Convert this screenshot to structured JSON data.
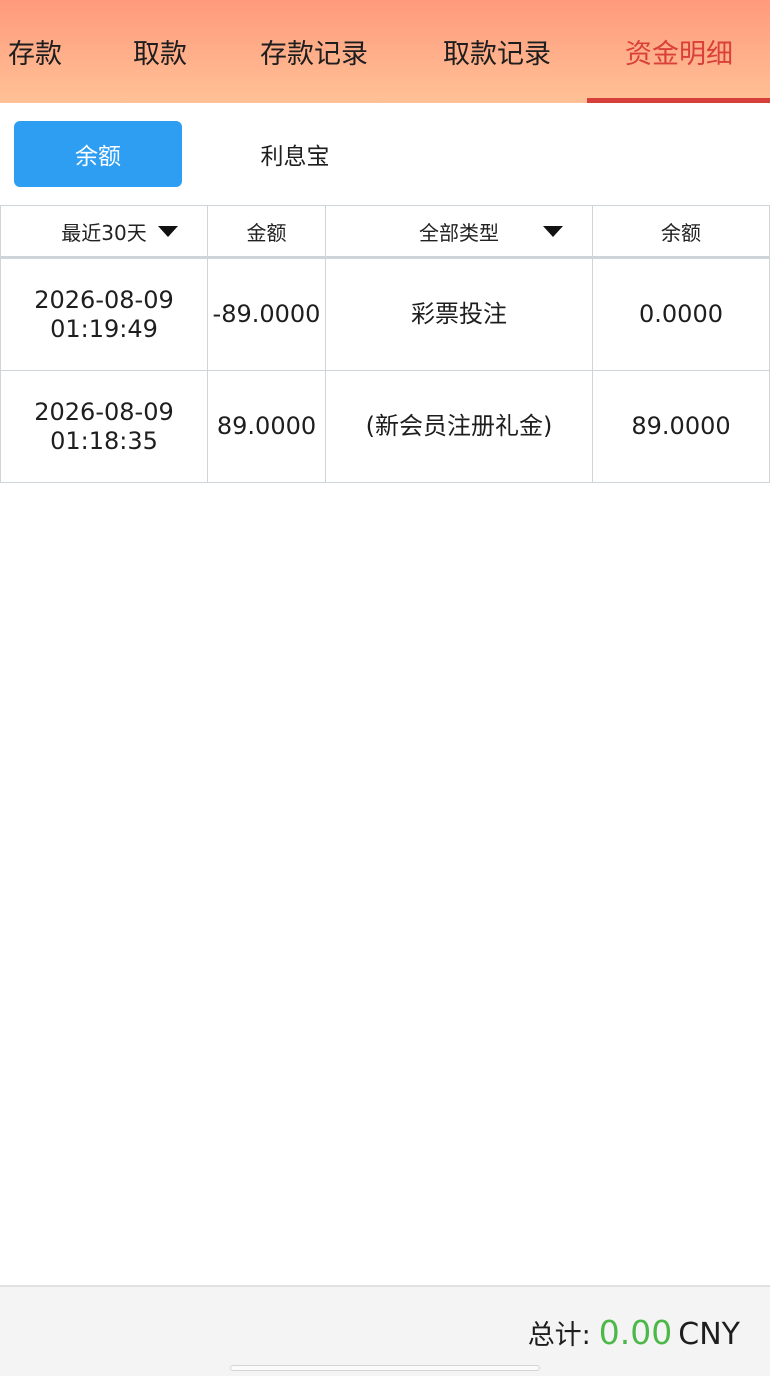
{
  "top_tabs": [
    {
      "label": "存款"
    },
    {
      "label": "取款"
    },
    {
      "label": "存款记录"
    },
    {
      "label": "取款记录"
    },
    {
      "label": "资金明细",
      "active": true
    }
  ],
  "sub_tabs": [
    {
      "label": "余额",
      "active": true
    },
    {
      "label": "利息宝"
    }
  ],
  "table": {
    "headers": {
      "date_filter": "最近30天",
      "amount": "金额",
      "type_filter": "全部类型",
      "balance": "余额"
    },
    "rows": [
      {
        "date": "2026-08-09",
        "time": "01:19:49",
        "amount": "-89.0000",
        "type": "彩票投注",
        "balance": "0.0000"
      },
      {
        "date": "2026-08-09",
        "time": "01:18:35",
        "amount": "89.0000",
        "type": "(新会员注册礼金)",
        "balance": "89.0000"
      }
    ]
  },
  "footer": {
    "total_label": "总计:",
    "total_amount": "0.00",
    "currency": "CNY"
  },
  "colors": {
    "accent_red": "#d63f3a",
    "accent_blue": "#2e9ef3",
    "total_green": "#4db84a",
    "header_gradient_top": "#ff9a7c",
    "header_gradient_bottom": "#ffc196"
  },
  "icons": {
    "date_filter": "caret-down-icon",
    "type_filter": "caret-down-icon"
  }
}
